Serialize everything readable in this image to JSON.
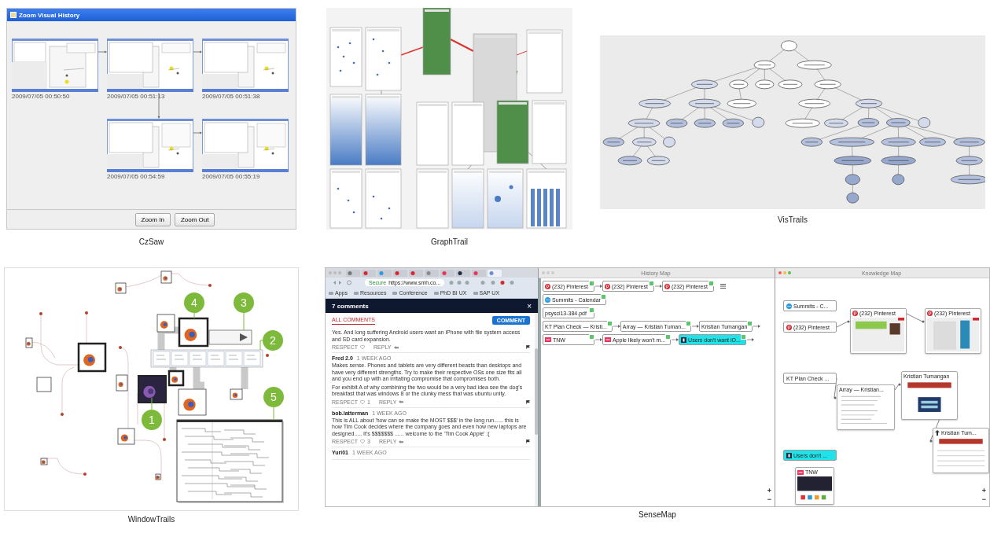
{
  "czsaw": {
    "title": "Zoom Visual History",
    "snapshots": [
      {
        "time": "2009/07/05 00:50:50"
      },
      {
        "time": "2009/07/05 00:51:13"
      },
      {
        "time": "2009/07/05 00:51:38"
      },
      {
        "time": "2009/07/05 00:54:59"
      },
      {
        "time": "2009/07/05 00:55:19"
      }
    ],
    "buttons": [
      "Zoom In",
      "Zoom Out"
    ],
    "caption": "CzSaw"
  },
  "graphtrail": {
    "caption": "GraphTrail"
  },
  "vistrails": {
    "caption": "VisTrails"
  },
  "windowtrails": {
    "markers": [
      "1",
      "2",
      "3",
      "4",
      "5"
    ],
    "caption": "WindowTrails"
  },
  "sensemap": {
    "browser": {
      "security": "Secure",
      "address": "https://www.smh.co...",
      "bookmarks": [
        "Apps",
        "Resources",
        "Conference",
        "PhD BI UX",
        "SAP UX"
      ],
      "panel_title": "7 comments",
      "close": "×",
      "filter_tab": "ALL COMMENTS",
      "comment_button": "COMMENT",
      "comments": [
        {
          "paragraphs": [
            "Yes. And long suffering Android users want an iPhone with file system access and SD card expansion."
          ],
          "actions": [
            "RESPECT",
            "REPLY"
          ]
        },
        {
          "author": "Fred 2.0",
          "time": "1 WEEK AGO",
          "paragraphs": [
            "Makes sense. Phones and tablets are very different beasts than desktops and have very different strengths. Try to make their respective OSs one size fits all and you end up with an irritating compromise that compromises both.",
            "For exhibit A of why combining the two would be a very bad idea see the dog's breakfast that was windows 8 or the clunky mess that was ubuntu unity."
          ],
          "actions": [
            "RESPECT",
            "REPLY"
          ],
          "respect_count": "1"
        },
        {
          "author": "bob.latterman",
          "time": "1 WEEK AGO",
          "paragraphs": [
            "This is ALL about 'how can se make the MOST $$$' in the long run...... this is how Tim Cook decides where the company goes and even how new laptops are designed..... It's $$$$$$$ ...... welcome to the 'Tim Cook Apple' :("
          ],
          "actions": [
            "RESPECT",
            "REPLY"
          ],
          "respect_count": "3"
        },
        {
          "author": "Yuri01",
          "time": "1 WEEK AGO"
        }
      ]
    },
    "history_map": {
      "title": "History Map",
      "rows": [
        {
          "continues": false,
          "nodes": [
            {
              "label": "(232) Pinterest",
              "kind": "pinterest",
              "highlighted": false
            },
            {
              "label": "(232) Pinterest",
              "kind": "pinterest",
              "highlighted": false
            },
            {
              "label": "(232) Pinterest",
              "kind": "pinterest",
              "highlighted": false
            }
          ]
        },
        {
          "continues": false,
          "nodes": [
            {
              "label": "Summits - Calendar",
              "kind": "calendar",
              "highlighted": false
            }
          ]
        },
        {
          "continues": false,
          "nodes": [
            {
              "label": "psysci13-384.pdf",
              "kind": "page",
              "highlighted": false
            }
          ]
        },
        {
          "continues": true,
          "nodes": [
            {
              "label": "KT Plan Check — Kristi...",
              "kind": "page",
              "highlighted": false
            },
            {
              "label": "Array — Kristian Tuman...",
              "kind": "page",
              "highlighted": false
            },
            {
              "label": "Kristian Tumangan",
              "kind": "page",
              "highlighted": false
            }
          ]
        },
        {
          "continues": true,
          "nodes": [
            {
              "label": "TNW",
              "kind": "tnw",
              "highlighted": false
            },
            {
              "label": "Apple likely won't m...",
              "kind": "tnw",
              "highlighted": false
            },
            {
              "label": "Users don't want iO...",
              "kind": "dark",
              "highlighted": true
            }
          ]
        }
      ],
      "zoom_buttons": [
        "+",
        "−"
      ]
    },
    "knowledge_map": {
      "title": "Knowledge Map",
      "nodes": [
        {
          "label": "Summits - C...",
          "kind": "chip",
          "highlighted": false
        },
        {
          "label": "(232) Pinterest",
          "kind": "chip",
          "highlighted": false
        },
        {
          "label": "(232) Pinterest",
          "kind": "card",
          "highlighted": false
        },
        {
          "label": "(232) Pinterest",
          "kind": "card",
          "highlighted": false
        },
        {
          "label": "KT Plan Check ...",
          "kind": "chip",
          "highlighted": false
        },
        {
          "label": "Array — Kristian...",
          "kind": "card",
          "highlighted": false
        },
        {
          "label": "Kristian Tumangan",
          "kind": "card",
          "highlighted": false
        },
        {
          "label": "Kristian Tum...",
          "kind": "card",
          "highlighted": false
        },
        {
          "label": "Users don't ...",
          "kind": "chip",
          "highlighted": true
        },
        {
          "label": "TNW",
          "kind": "card",
          "highlighted": false
        }
      ],
      "zoom_buttons": [
        "+",
        "−"
      ]
    },
    "caption": "SenseMap"
  }
}
